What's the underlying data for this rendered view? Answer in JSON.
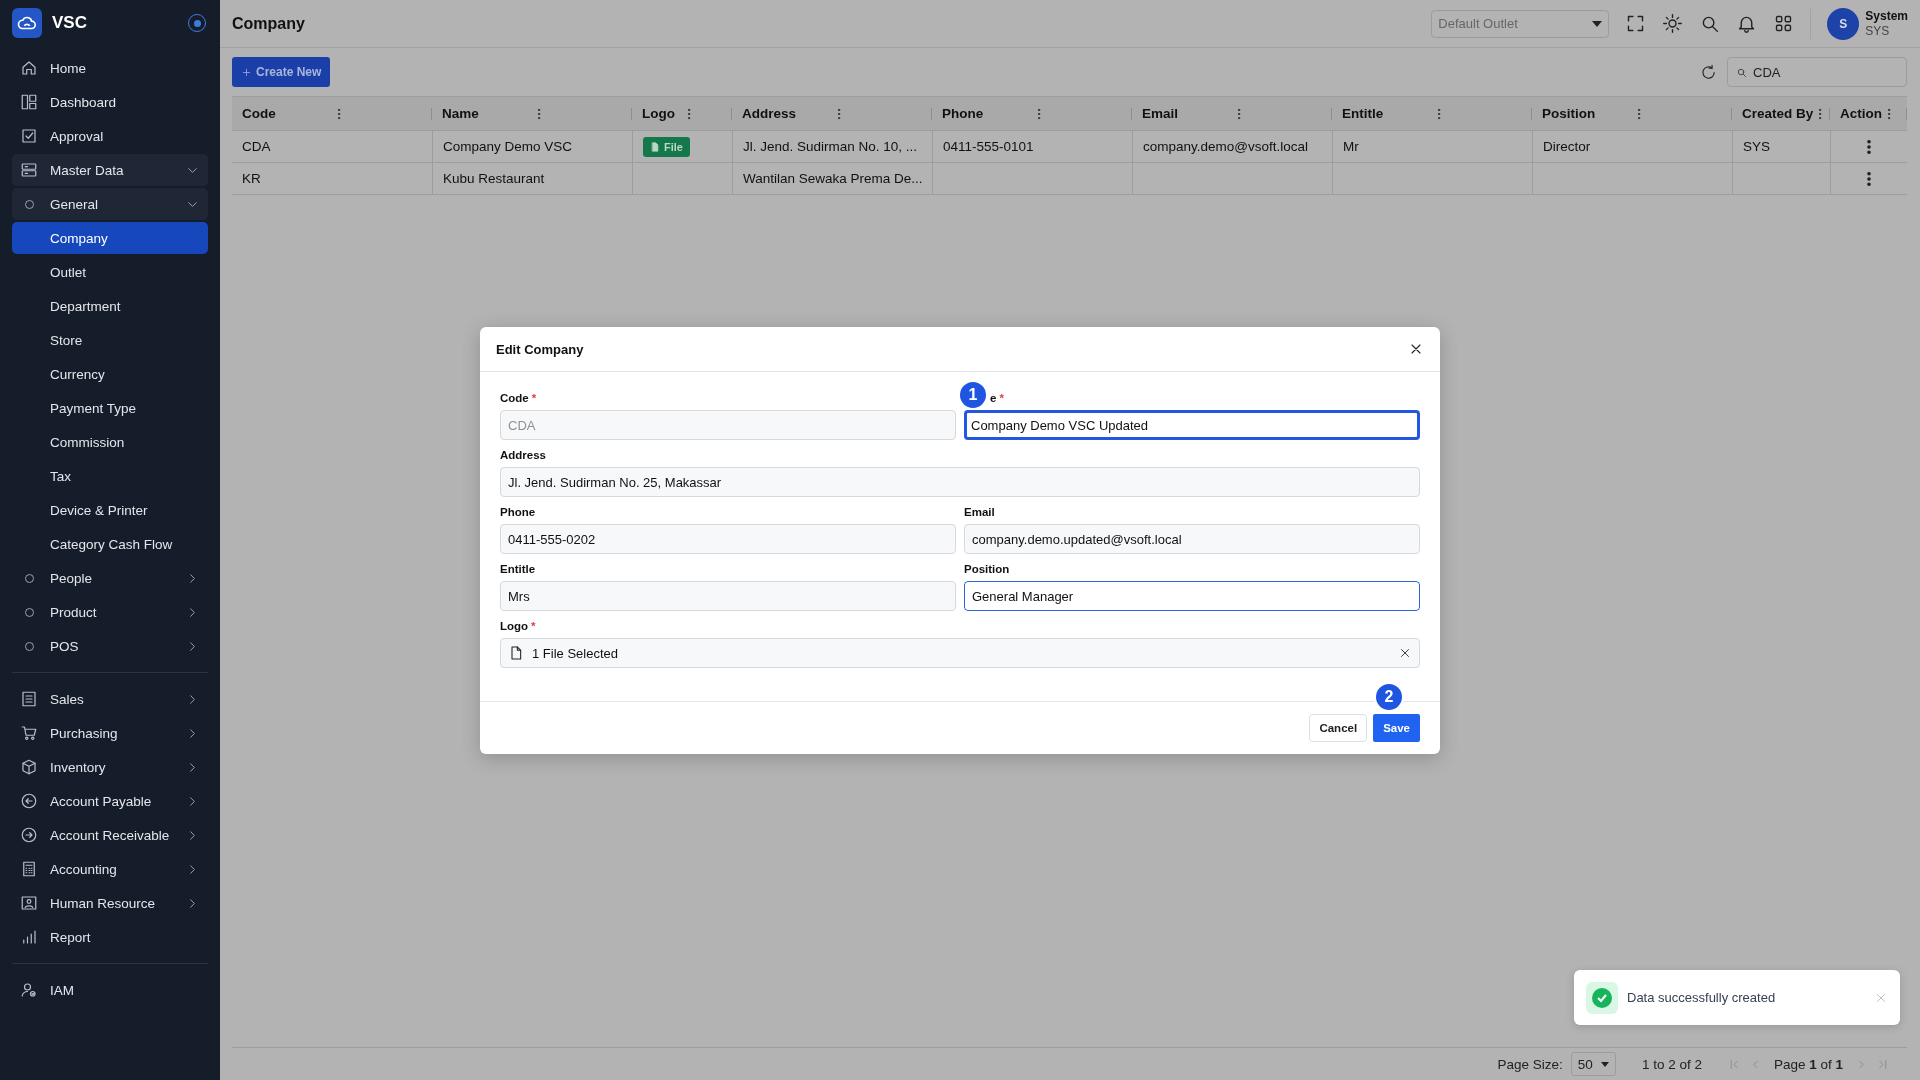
{
  "sidebar": {
    "brand": "VSC",
    "sections": [
      {
        "items": [
          {
            "label": "Home",
            "selected": false
          },
          {
            "label": "Dashboard",
            "selected": false
          },
          {
            "label": "Approval",
            "selected": false
          },
          {
            "label": "Master Data",
            "selected": false,
            "expanded": true,
            "children": [
              {
                "label": "General",
                "selected": false,
                "expanded": true,
                "children": [
                  {
                    "label": "Company",
                    "selected": true
                  },
                  {
                    "label": "Outlet",
                    "selected": false
                  },
                  {
                    "label": "Department",
                    "selected": false
                  },
                  {
                    "label": "Store",
                    "selected": false
                  },
                  {
                    "label": "Currency",
                    "selected": false
                  },
                  {
                    "label": "Payment Type",
                    "selected": false
                  },
                  {
                    "label": "Commission",
                    "selected": false
                  },
                  {
                    "label": "Tax",
                    "selected": false
                  },
                  {
                    "label": "Device & Printer",
                    "selected": false
                  },
                  {
                    "label": "Category Cash Flow",
                    "selected": false
                  }
                ]
              },
              {
                "label": "People",
                "selected": false,
                "expanded": false
              },
              {
                "label": "Product",
                "selected": false,
                "expanded": false
              },
              {
                "label": "POS",
                "selected": false,
                "expanded": false
              }
            ]
          }
        ]
      },
      {
        "items": [
          {
            "label": "Sales",
            "selected": false,
            "expanded": false
          },
          {
            "label": "Purchasing",
            "selected": false,
            "expanded": false
          },
          {
            "label": "Inventory",
            "selected": false,
            "expanded": false
          },
          {
            "label": "Account Payable",
            "selected": false,
            "expanded": false
          },
          {
            "label": "Account Receivable",
            "selected": false,
            "expanded": false
          },
          {
            "label": "Accounting",
            "selected": false,
            "expanded": false
          },
          {
            "label": "Human Resource",
            "selected": false,
            "expanded": false
          },
          {
            "label": "Report",
            "selected": false
          }
        ]
      },
      {
        "items": [
          {
            "label": "IAM",
            "selected": false
          }
        ]
      }
    ]
  },
  "header": {
    "title": "Company",
    "outlet_select": {
      "placeholder": "Default Outlet"
    },
    "user": {
      "initial": "S",
      "name": "System",
      "code": "SYS"
    }
  },
  "toolbar": {
    "create_button": "Create New",
    "search": {
      "value": "CDA"
    }
  },
  "table": {
    "columns": [
      "Code",
      "Name",
      "Logo",
      "Address",
      "Phone",
      "Email",
      "Entitle",
      "Position",
      "Created By",
      "Action"
    ],
    "rows": [
      {
        "cells": [
          "CDA",
          "Company Demo VSC",
          {
            "file": "File"
          },
          "Jl. Jend. Sudirman No. 10, ...",
          "0411-555-0101",
          "company.demo@vsoft.local",
          "Mr",
          "Director",
          "SYS"
        ]
      },
      {
        "cells": [
          "KR",
          "Kubu Restaurant",
          "",
          "Wantilan Sewaka Prema De...",
          "",
          "",
          "",
          "",
          ""
        ]
      }
    ]
  },
  "modal": {
    "title": "Edit Company",
    "fields": [
      {
        "kind": "text",
        "label": "Code",
        "required_mark": "*",
        "value": "CDA",
        "disabled": true,
        "focused": false,
        "full": false
      },
      {
        "kind": "text",
        "label": "e",
        "required_mark": "*",
        "value": "Company Demo VSC Updated",
        "disabled": false,
        "focused": true,
        "highlighted": true,
        "annotation": "1",
        "full": false
      },
      {
        "kind": "text",
        "label": "Address",
        "value": "Jl. Jend. Sudirman No. 25, Makassar",
        "disabled": false,
        "focused": false,
        "full": true
      },
      {
        "kind": "text",
        "label": "Phone",
        "value": "0411-555-0202",
        "disabled": false,
        "focused": false,
        "full": false
      },
      {
        "kind": "text",
        "label": "Email",
        "value": "company.demo.updated@vsoft.local",
        "disabled": false,
        "focused": false,
        "full": false
      },
      {
        "kind": "text",
        "label": "Entitle",
        "value": "Mrs",
        "disabled": false,
        "focused": false,
        "full": false
      },
      {
        "kind": "text",
        "label": "Position",
        "value": "General Manager",
        "disabled": false,
        "focused": true,
        "full": false
      },
      {
        "kind": "file",
        "label": "Logo",
        "required_mark": "*",
        "value": "1 File Selected",
        "disabled": false,
        "focused": false,
        "full": true
      }
    ],
    "cancel_button": "Cancel",
    "save_button": {
      "label": "Save",
      "annotation": "2"
    }
  },
  "toast": {
    "message": "Data successfully created"
  },
  "pager": {
    "page_size_label": "Page Size:",
    "page_size": "50",
    "range": "1 to 2 of 2",
    "page": "Page **1** of **1**"
  }
}
